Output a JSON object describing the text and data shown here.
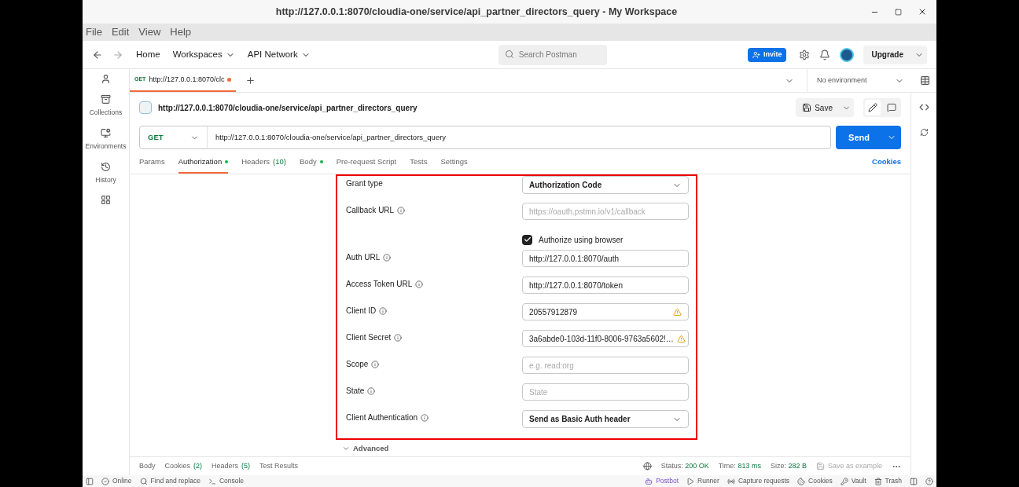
{
  "window": {
    "title": "http://127.0.0.1:8070/cloudia-one/service/api_partner_directors_query - My Workspace"
  },
  "menu": [
    "File",
    "Edit",
    "View",
    "Help"
  ],
  "nav": {
    "links": [
      {
        "label": "Home",
        "dropdown": false
      },
      {
        "label": "Workspaces",
        "dropdown": true
      },
      {
        "label": "API Network",
        "dropdown": true
      }
    ],
    "search": {
      "placeholder": "Search Postman"
    },
    "invite": "Invite",
    "upgrade": "Upgrade"
  },
  "sidebar": {
    "items": [
      {
        "kind": "account"
      },
      {
        "label": "Collections",
        "kind": "collections"
      },
      {
        "label": "Environments",
        "kind": "environments"
      },
      {
        "label": "History",
        "kind": "history"
      },
      {
        "kind": "apps"
      }
    ]
  },
  "request_tabs": [
    {
      "method": "GET",
      "label": "http://127.0.0.1:8070/clc",
      "selected": true,
      "unsaved": true
    }
  ],
  "environment": "No environment",
  "request": {
    "title": "http://127.0.0.1:8070/cloudia-one/service/api_partner_directors_query",
    "save": "Save",
    "method": "GET",
    "url": "http://127.0.0.1:8070/cloudia-one/service/api_partner_directors_query",
    "send": "Send"
  },
  "tabs": [
    {
      "label": "Params",
      "dot": false,
      "selected": false
    },
    {
      "label": "Authorization",
      "dot": true,
      "selected": true
    },
    {
      "label": "Headers",
      "count": "(10)",
      "dot": false,
      "selected": false
    },
    {
      "label": "Body",
      "dot": true,
      "selected": false
    },
    {
      "label": "Pre-request Script",
      "dot": false,
      "selected": false
    },
    {
      "label": "Tests",
      "dot": false,
      "selected": false
    },
    {
      "label": "Settings",
      "dot": false,
      "selected": false
    }
  ],
  "cookies_link": "Cookies",
  "form": [
    {
      "label": "Grant type",
      "kind": "select",
      "info": false,
      "value": "Authorization Code"
    },
    {
      "label": "Callback URL",
      "kind": "input",
      "info": true,
      "placeholder": "https://oauth.pstmn.io/v1/callback"
    },
    {
      "label": "Authorize using browser",
      "kind": "checkbox",
      "checked": true
    },
    {
      "label": "Auth URL",
      "kind": "input",
      "info": true,
      "value": "http://127.0.0.1:8070/auth",
      "warning": false
    },
    {
      "label": "Access Token URL",
      "kind": "input",
      "info": true,
      "value": "http://127.0.0.1:8070/token",
      "warning": false
    },
    {
      "label": "Client ID",
      "kind": "input",
      "info": true,
      "value": "20557912879",
      "warning": true
    },
    {
      "label": "Client Secret",
      "kind": "input",
      "info": true,
      "value": "3a6abde0-103d-11f0-8006-9763a5602!…",
      "warning": true
    },
    {
      "label": "Scope",
      "kind": "input",
      "info": true,
      "placeholder": "e.g. read:org"
    },
    {
      "label": "State",
      "kind": "input",
      "info": true,
      "placeholder": "State"
    },
    {
      "label": "Client Authentication",
      "kind": "select",
      "info": true,
      "value": "Send as Basic Auth header"
    }
  ],
  "advanced": "Advanced",
  "response": {
    "tabs": [
      {
        "label": "Body"
      },
      {
        "label": "Cookies",
        "count": "(2)"
      },
      {
        "label": "Headers",
        "count": "(5)"
      },
      {
        "label": "Test Results"
      }
    ],
    "stats": [
      {
        "label": "Status:",
        "value": "200 OK"
      },
      {
        "label": "Time:",
        "value": "813 ms"
      },
      {
        "label": "Size:",
        "value": "282 B"
      }
    ],
    "save_example": "Save as example"
  },
  "status_bar": {
    "left": [
      {
        "label": "Online",
        "kind": "online"
      },
      {
        "label": "Find and replace",
        "kind": "find"
      },
      {
        "label": "Console",
        "kind": "console"
      }
    ],
    "right": [
      {
        "label": "Postbot",
        "kind": "postbot"
      },
      {
        "label": "Runner",
        "kind": "runner"
      },
      {
        "label": "Capture requests",
        "kind": "capture"
      },
      {
        "label": "Cookies",
        "kind": "cookies"
      },
      {
        "label": "Vault",
        "kind": "vault"
      },
      {
        "label": "Trash",
        "kind": "trash"
      }
    ]
  }
}
